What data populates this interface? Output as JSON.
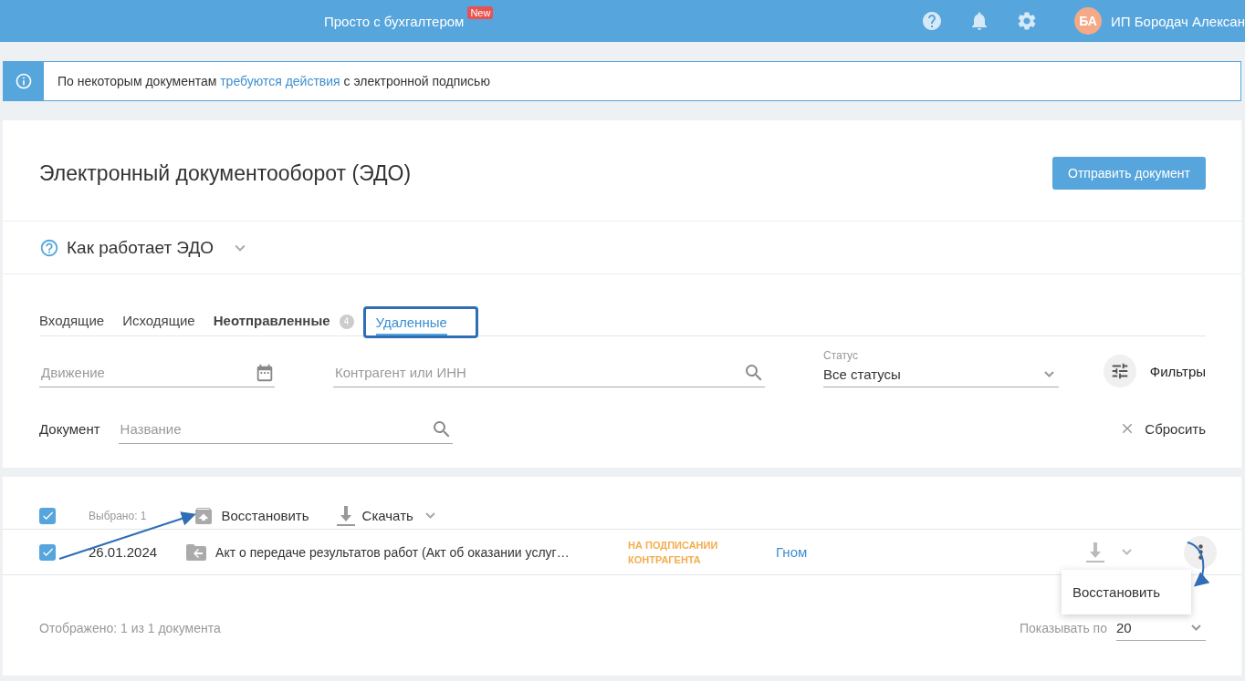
{
  "topbar": {
    "title": "Просто с бухгалтером",
    "badge": "New",
    "user": {
      "initials": "БА",
      "name": "ИП Бородач Алексан"
    }
  },
  "notice": {
    "before": "По некоторым документам ",
    "link": "требуются действия",
    "after": " с электронной подписью"
  },
  "page": {
    "title": "Электронный документооборот (ЭДО)",
    "primary_button": "Отправить документ"
  },
  "help": {
    "label": "Как работает ЭДО",
    "expanded": false
  },
  "tabs": [
    {
      "label": "Входящие",
      "selected": false,
      "bold": false
    },
    {
      "label": "Исходящие",
      "selected": false,
      "bold": false
    },
    {
      "label": "Неотправленные",
      "selected": false,
      "bold": true,
      "count": "4"
    },
    {
      "label": "Удаленные",
      "selected": true,
      "bold": false,
      "highlighted": true
    }
  ],
  "filters": {
    "movement": {
      "placeholder": "Движение"
    },
    "counterparty": {
      "placeholder": "Контрагент или ИНН"
    },
    "status": {
      "label": "Статус",
      "value": "Все статусы"
    },
    "filters_button": "Фильтры",
    "document_label": "Документ",
    "name": {
      "placeholder": "Название"
    },
    "reset": "Сбросить"
  },
  "toolbar": {
    "all_checked": true,
    "selected_count": "Выбрано: 1",
    "restore": "Восстановить",
    "download": "Скачать"
  },
  "rows": [
    {
      "checked": true,
      "date": "26.01.2024",
      "title": "Акт о передаче результатов работ (Акт об оказании услуг…",
      "status": "НА ПОДПИСАНИИ КОНТРАГЕНТА",
      "counterparty": "Гном"
    }
  ],
  "context_menu": {
    "items": [
      "Восстановить"
    ]
  },
  "footer": {
    "shown": "Отображено: 1 из 1 документа",
    "per_page_label": "Показывать по",
    "per_page": "20"
  }
}
